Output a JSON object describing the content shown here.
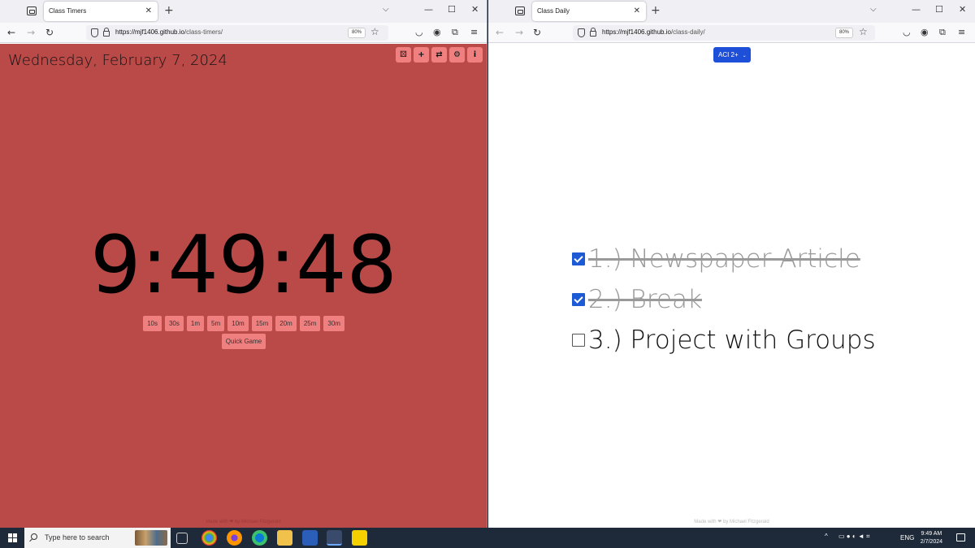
{
  "left_window": {
    "tab_title": "Class Timers",
    "url_host": "https://mjf1406.github.io",
    "url_path": "/class-timers/",
    "zoom": "80%"
  },
  "right_window": {
    "tab_title": "Class Daily",
    "url_host": "https://mjf1406.github.io",
    "url_path": "/class-daily/",
    "zoom": "80%"
  },
  "timers": {
    "date": "Wednesday, February 7, 2024",
    "clock": "9:49:48",
    "presets": [
      "10s",
      "30s",
      "1m",
      "5m",
      "10m",
      "15m",
      "20m",
      "25m",
      "30m"
    ],
    "quick_game": "Quick Game",
    "icon_buttons": [
      "dice-icon",
      "plus-icon",
      "repeat-icon",
      "gear-icon",
      "info-icon"
    ],
    "footer": "Made with ❤ by Michael Fitzgerald"
  },
  "daily": {
    "class_selector": "ACI 2+",
    "tasks": [
      {
        "label": "1.) Newspaper Article",
        "done": true
      },
      {
        "label": "2.) Break",
        "done": true
      },
      {
        "label": "3.) Project with Groups",
        "done": false
      }
    ],
    "footer": "Made with ❤ by Michael Fitzgerald"
  },
  "taskbar": {
    "search_placeholder": "Type here to search",
    "lang": "ENG",
    "time": "9:49 AM",
    "date": "2/7/2024",
    "apps": [
      "task-view-icon",
      "chrome-icon",
      "firefox-icon",
      "edge-icon",
      "file-explorer-icon",
      "word-icon",
      "app-icon",
      "chat-icon"
    ]
  },
  "colors": {
    "timer_bg": "#b94a48",
    "timer_button": "#f08080",
    "accent_blue": "#1d4fd8"
  }
}
